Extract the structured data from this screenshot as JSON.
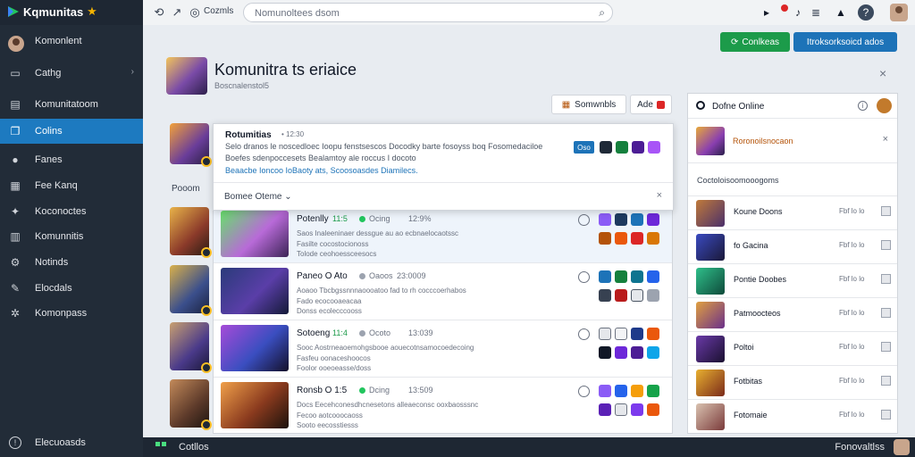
{
  "app": {
    "name": "Kqmunitas",
    "star": "★"
  },
  "browser": {
    "tab_label": "Cozmls",
    "url_placeholder": "Nomunoltees dsom"
  },
  "sidebar": {
    "items": [
      {
        "label": "Komonlent",
        "icon": "avatar"
      },
      {
        "label": "Cathg",
        "icon": "folder-icon",
        "caret": "›"
      },
      {
        "label": "Komunitatoom",
        "icon": "document-icon"
      },
      {
        "label": "Colins",
        "icon": "copy-icon",
        "active": true
      },
      {
        "label": "Fanes",
        "icon": "chat-icon"
      },
      {
        "label": "Fee Kanq",
        "icon": "grid-icon"
      },
      {
        "label": "Koconoctes",
        "icon": "pin-icon"
      },
      {
        "label": "Komunnitis",
        "icon": "chart-icon"
      },
      {
        "label": "Notinds",
        "icon": "gear-icon"
      },
      {
        "label": "Elocdals",
        "icon": "tag-icon"
      },
      {
        "label": "Komonpass",
        "icon": "cog-icon"
      }
    ],
    "footer_label": "Elecuoasds"
  },
  "header": {
    "title": "Komunitra ts eriaice",
    "subtitle": "Boscnalenstol5",
    "green_button": "Conlkeas",
    "blue_button": "Itroksorksoicd ados",
    "close": "×",
    "sort_label": "Somwnbls",
    "add_label": "Ade"
  },
  "left_column": {
    "title": "Pooom"
  },
  "popup": {
    "title": "Rotumitias",
    "time": "• 12:30",
    "line1": "Selo dranos le noscedloec Ioopu fenstsescos Docodky barte fosoyss boq Fosomedaciloe",
    "line2": "Boefes sdenpoccesets Bealamtoy ale roccus I docoto",
    "link": "Beaacbe Ioncoo IoBaoty ats, Scoosoasdes Diamilecs.",
    "tag": "Oso",
    "footer_label": "Bomee Oteme",
    "footer_caret": "⌄",
    "close": "×"
  },
  "games": [
    {
      "title": "Potenlly",
      "meta1": "11:5",
      "meta2": "Ocing",
      "meta3": "12:9%",
      "line1": "Saos Inaleeninaer dessgue au ao ecbnaelocaotssc",
      "line2": "Fasilte cocostocionoss",
      "line3": "Tolode ceohoessceesocs"
    },
    {
      "title": "Paneo O Ato",
      "meta1": "Oaoos",
      "meta2": "",
      "meta3": "23:0009",
      "line1": "Aoaoo Tbcbgssnnnaoooatoo fad to rh cocccoerhabos",
      "line2": "Fado ecocooaeacaa",
      "line3": "Donss ecolecccooss"
    },
    {
      "title": "Sotoeng",
      "meta1": "11:4",
      "meta2": "Ocoto",
      "meta3": "13:039",
      "line1": "Sooc Aostrneaoemohgsbooe aouecotnsamocoedecoing",
      "line2": "Fasfeu oonaceshoocos",
      "line3": "Foolor ooeoeasse/doss"
    },
    {
      "title": "Ronsb O 1:5",
      "meta1": "Dcing",
      "meta2": "",
      "meta3": "13:509",
      "line1": "Docs Eecehconesdhcnesetons alleaeconsc ooxbaosssnc",
      "line2": "Fecoo aotcooocaoss",
      "line3": "Sooto eecosstiesss"
    }
  ],
  "right_panel": {
    "title": "Dofne Online",
    "info": "i",
    "featured": "Roronoilsnocaon",
    "featured_close": "×",
    "section": "Coctoloisoomooogoms",
    "items": [
      {
        "label": "Koune Doons",
        "meta": "Fbf lo lo"
      },
      {
        "label": "fo Gacina",
        "meta": "Fbf lo lo"
      },
      {
        "label": "Pontie Doobes",
        "meta": "Fbf lo lo"
      },
      {
        "label": "Patmoocteos",
        "meta": "Fbf lo lo"
      },
      {
        "label": "Poltoi",
        "meta": "Fbf lo lo"
      },
      {
        "label": "Fotbitas",
        "meta": "Fbf lo lo"
      },
      {
        "label": "Fotomaie",
        "meta": "Fbf lo lo"
      }
    ]
  },
  "bottombar": {
    "label": "Cotllos",
    "right_label": "Fonovaltlss"
  },
  "colors": {
    "sidebar_bg": "#222c38",
    "active_item": "#1d7ac0",
    "green_button": "#1c9b4a",
    "blue_button": "#1d73b8",
    "online_dot": "#22c55e"
  }
}
